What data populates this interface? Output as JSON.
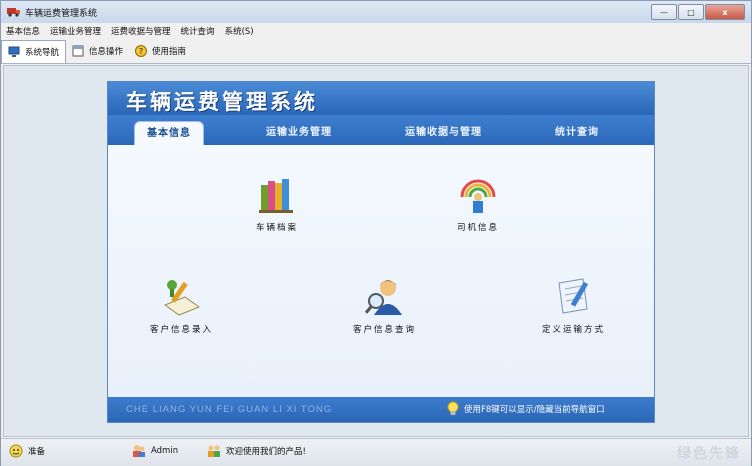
{
  "window": {
    "title": "车辆运费管理系统",
    "minimize": "—",
    "maximize": "□",
    "close": "x"
  },
  "menubar": [
    "基本信息",
    "运输业务管理",
    "运费收据与管理",
    "统计查询",
    "系统(S)"
  ],
  "tabs": [
    {
      "label": "系统导航",
      "icon": "monitor-icon"
    },
    {
      "label": "信息操作",
      "icon": "window-icon"
    },
    {
      "label": "使用指南",
      "icon": "help-icon"
    }
  ],
  "panel": {
    "title": "车辆运费管理系统",
    "nav": [
      "基本信息",
      "运输业务管理",
      "运输收据与管理",
      "统计查询"
    ],
    "items": [
      {
        "label": "车辆档案",
        "icon": "books-icon"
      },
      {
        "label": "司机信息",
        "icon": "rainbow-person-icon"
      },
      {
        "label": "客户信息录入",
        "icon": "pen-paper-icon"
      },
      {
        "label": "客户信息查询",
        "icon": "user-search-icon"
      },
      {
        "label": "定义运输方式",
        "icon": "document-edit-icon"
      }
    ],
    "footer_pinyin": "CHE LIANG YUN FEI GUAN LI XI TONG",
    "footer_tip": "使用F8键可以显示/隐藏当前导航窗口"
  },
  "status": {
    "ready": "准备",
    "user": "Admin",
    "welcome": "欢迎使用我们的产品!"
  },
  "watermark": "绿色先锋"
}
